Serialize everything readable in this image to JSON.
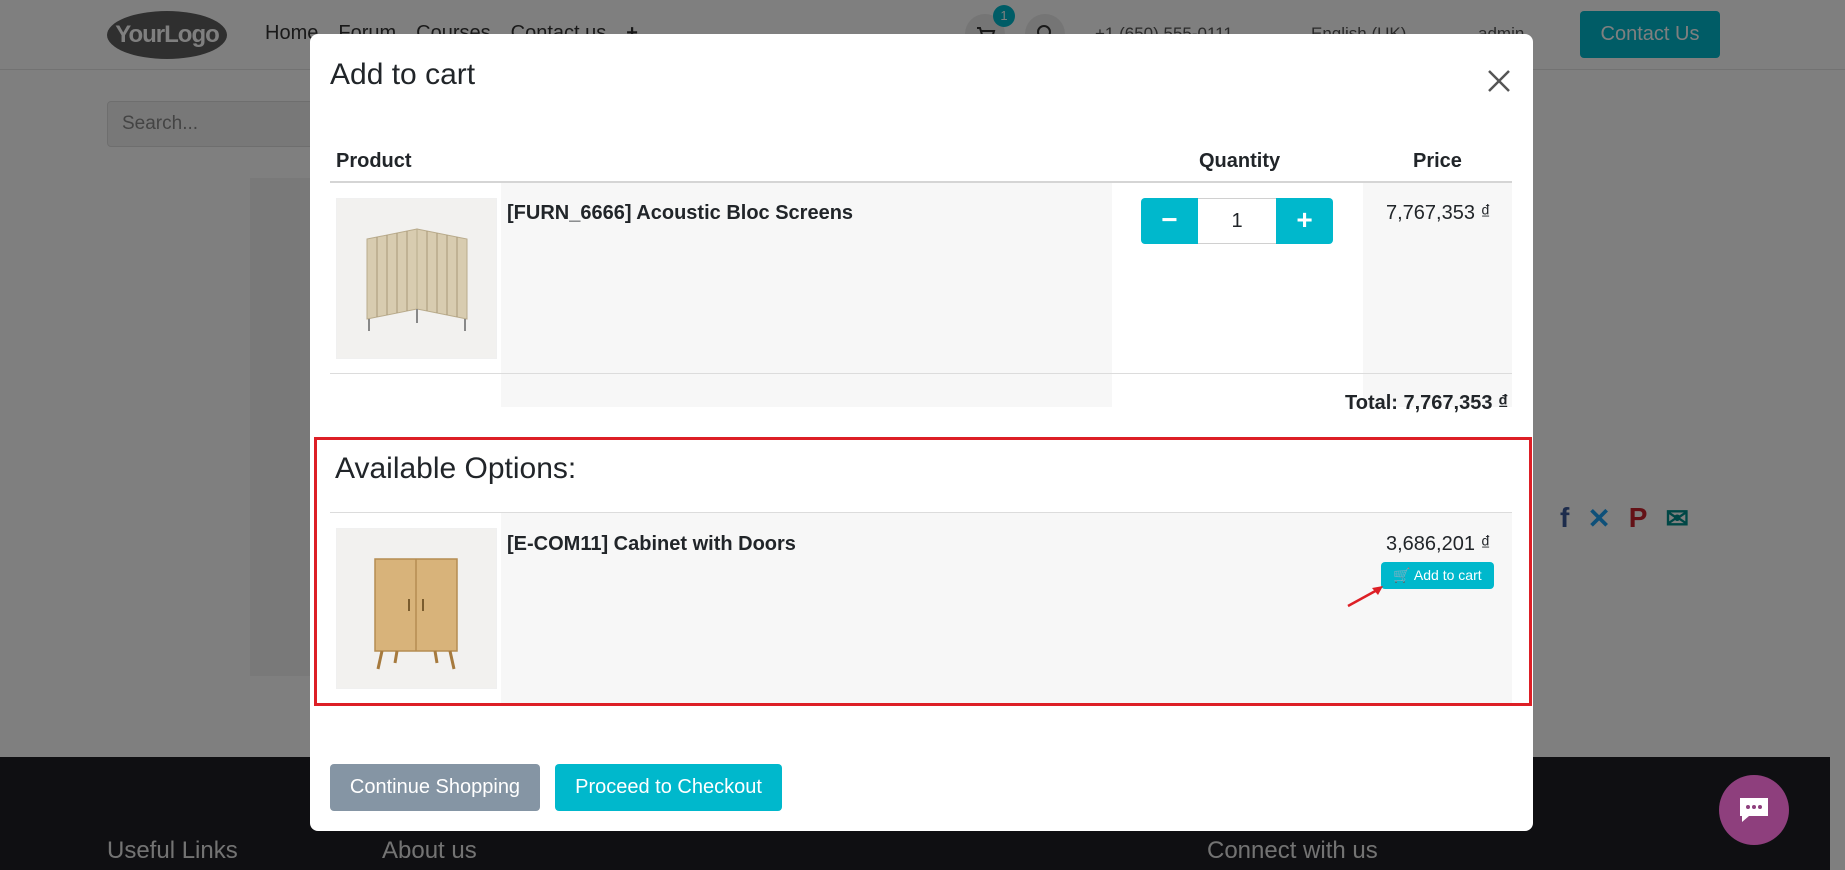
{
  "background": {
    "logo_text": "YourLogo",
    "nav": [
      "Home",
      "Forum",
      "Courses",
      "Contact us"
    ],
    "nav_plus": "+",
    "cart_count": "1",
    "phone": "+1 (650) 555-0111",
    "language": "English (UK)",
    "user": "admin",
    "contact_button": "Contact Us",
    "search_placeholder": "Search...",
    "social_icons": [
      "facebook-icon",
      "x-icon",
      "pinterest-icon",
      "email-icon"
    ],
    "footer": {
      "useful_links": "Useful Links",
      "about_us": "About us",
      "connect": "Connect with us"
    }
  },
  "modal": {
    "title": "Add to cart",
    "columns": {
      "product": "Product",
      "quantity": "Quantity",
      "price": "Price"
    },
    "product": {
      "name": "[FURN_6666] Acoustic Bloc Screens",
      "quantity": "1",
      "price": "7,767,353 ₫"
    },
    "total": "Total: 7,767,353 ₫",
    "options": {
      "title": "Available Options:",
      "items": [
        {
          "name": "[E-COM11] Cabinet with Doors",
          "price": "3,686,201 ₫",
          "button": "Add to cart"
        }
      ]
    },
    "buttons": {
      "continue": "Continue Shopping",
      "checkout": "Proceed to Checkout"
    }
  },
  "colors": {
    "accent": "#00b8cc",
    "secondary": "#8595a4",
    "highlight": "#dd1f26",
    "chat": "#8e3f7d"
  }
}
